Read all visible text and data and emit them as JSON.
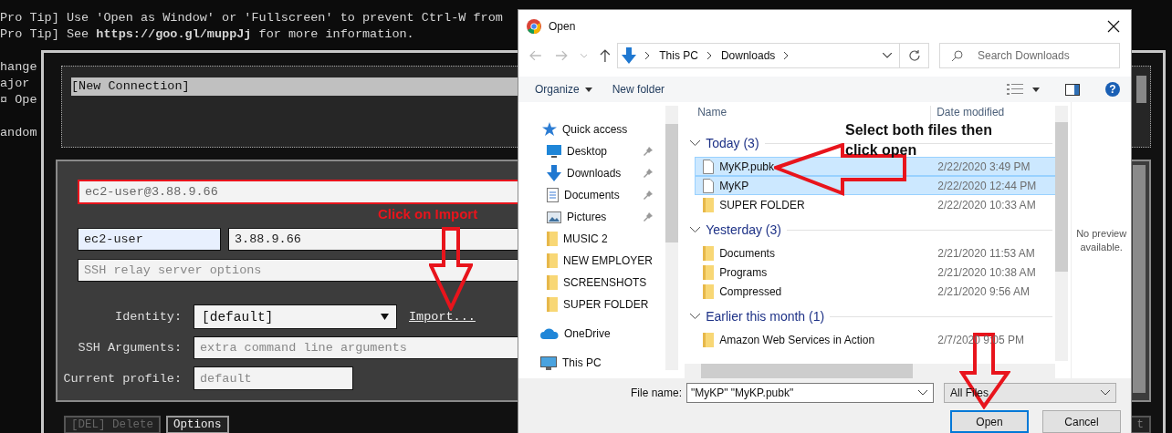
{
  "terminal": {
    "blocks": [
      {
        "lines": [
          "Pro Tip] Use 'Open as Window' or 'Fullscreen' to prevent Ctrl-W from",
          "Pro Tip] See **https://goo.gl/muppJj** for more information."
        ]
      },
      {
        "lines": [
          "hange",
          "ajor",
          "¤ Ope"
        ]
      },
      {
        "lines": [
          "andom"
        ]
      }
    ]
  },
  "ssh": {
    "connections": [
      {
        "label": "[New Connection]",
        "selected": true
      }
    ],
    "form": {
      "address": "ec2-user@3.88.9.66",
      "user": "ec2-user",
      "host": "3.88.9.66",
      "relay_placeholder": "SSH relay server options",
      "identity_label": "Identity:",
      "identity_value": "[default]",
      "import_link": "Import...",
      "args_label": "SSH Arguments:",
      "args_placeholder": "extra command line arguments",
      "profile_label": "Current profile:",
      "profile_placeholder": "default"
    },
    "buttons": [
      {
        "label": "[DEL] Delete",
        "disabled": true
      },
      {
        "label": "Options",
        "disabled": false
      }
    ],
    "partial_button": "t"
  },
  "dialog": {
    "title": "Open",
    "breadcrumb": [
      "This PC",
      "Downloads"
    ],
    "search_placeholder": "Search Downloads",
    "toolbar": {
      "organize": "Organize",
      "new_folder": "New folder",
      "help": "?"
    },
    "nav": [
      {
        "label": "Quick access",
        "kind": "quick",
        "pinned": false
      },
      {
        "label": "Desktop",
        "kind": "desktop",
        "pinned": true
      },
      {
        "label": "Downloads",
        "kind": "downloads",
        "pinned": true
      },
      {
        "label": "Documents",
        "kind": "documents",
        "pinned": true
      },
      {
        "label": "Pictures",
        "kind": "pictures",
        "pinned": true
      },
      {
        "label": "MUSIC 2",
        "kind": "folder",
        "pinned": false
      },
      {
        "label": "NEW EMPLOYER",
        "kind": "folder",
        "pinned": false
      },
      {
        "label": "SCREENSHOTS",
        "kind": "folder",
        "pinned": false
      },
      {
        "label": "SUPER FOLDER",
        "kind": "folder",
        "pinned": false
      },
      {
        "label": "OneDrive",
        "kind": "onedrive",
        "pinned": false
      },
      {
        "label": "This PC",
        "kind": "pc",
        "pinned": false
      }
    ],
    "columns": [
      "Name",
      "Date modified"
    ],
    "groups": [
      {
        "title": "Today (3)",
        "files": [
          {
            "name": "MyKP.pubk",
            "date": "2/22/2020 3:49 PM",
            "kind": "file",
            "selected": true
          },
          {
            "name": "MyKP",
            "date": "2/22/2020 12:44 PM",
            "kind": "file",
            "selected": true
          },
          {
            "name": "SUPER FOLDER",
            "date": "2/22/2020 10:33 AM",
            "kind": "folder",
            "selected": false
          }
        ]
      },
      {
        "title": "Yesterday (3)",
        "files": [
          {
            "name": "Documents",
            "date": "2/21/2020 11:53 AM",
            "kind": "folder",
            "selected": false
          },
          {
            "name": "Programs",
            "date": "2/21/2020 10:38 AM",
            "kind": "folder",
            "selected": false
          },
          {
            "name": "Compressed",
            "date": "2/21/2020 9:56 AM",
            "kind": "folder",
            "selected": false
          }
        ]
      },
      {
        "title": "Earlier this month (1)",
        "files": [
          {
            "name": "Amazon Web Services in Action",
            "date": "2/7/2020 9:05 PM",
            "kind": "folder",
            "selected": false
          }
        ]
      }
    ],
    "preview": "No preview available.",
    "file_name_label": "File name:",
    "file_name": "\"MyKP\" \"MyKP.pubk\"",
    "filter": "All Files",
    "buttons": [
      {
        "label": "Open",
        "kind": "default"
      },
      {
        "label": "Cancel",
        "kind": "normal"
      }
    ]
  },
  "annotations": {
    "import_note": "Click on Import",
    "select_note": "Select both files then click open"
  }
}
